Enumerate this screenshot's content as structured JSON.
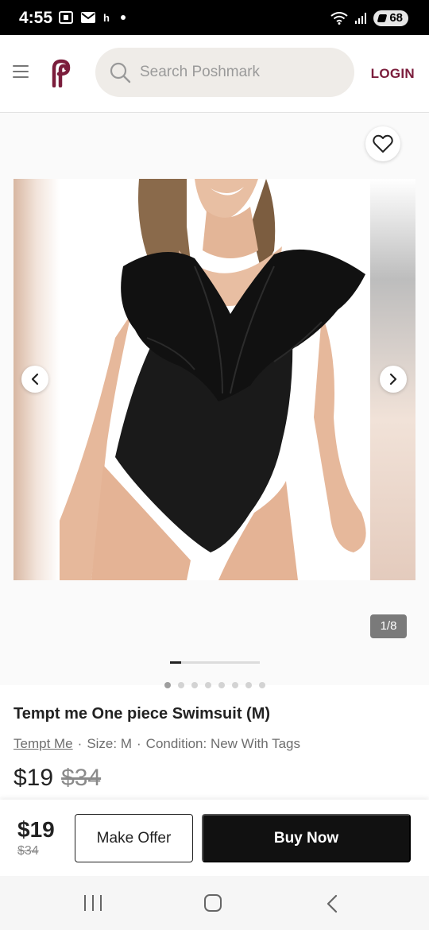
{
  "status_bar": {
    "time": "4:55",
    "left_icons": [
      "screenshot-icon",
      "mail-icon",
      "h",
      "dot"
    ],
    "left_h": "h",
    "battery": "68",
    "right_icons": [
      "wifi-icon",
      "signal-icon",
      "battery-saver-icon"
    ]
  },
  "header": {
    "search_placeholder": "Search Poshmark",
    "login_label": "LOGIN",
    "brand_color": "#7b1d3c"
  },
  "gallery": {
    "counter": "1/8",
    "image_count": 8,
    "active_index": 0
  },
  "listing": {
    "title": "Tempt me One piece Swimsuit (M)",
    "brand": "Tempt Me",
    "separator": "·",
    "size": "Size: M",
    "condition": "Condition: New With Tags",
    "price": "$19",
    "original_price": "$34"
  },
  "bottom_bar": {
    "price": "$19",
    "original_price": "$34",
    "make_offer_label": "Make Offer",
    "buy_now_label": "Buy Now"
  }
}
